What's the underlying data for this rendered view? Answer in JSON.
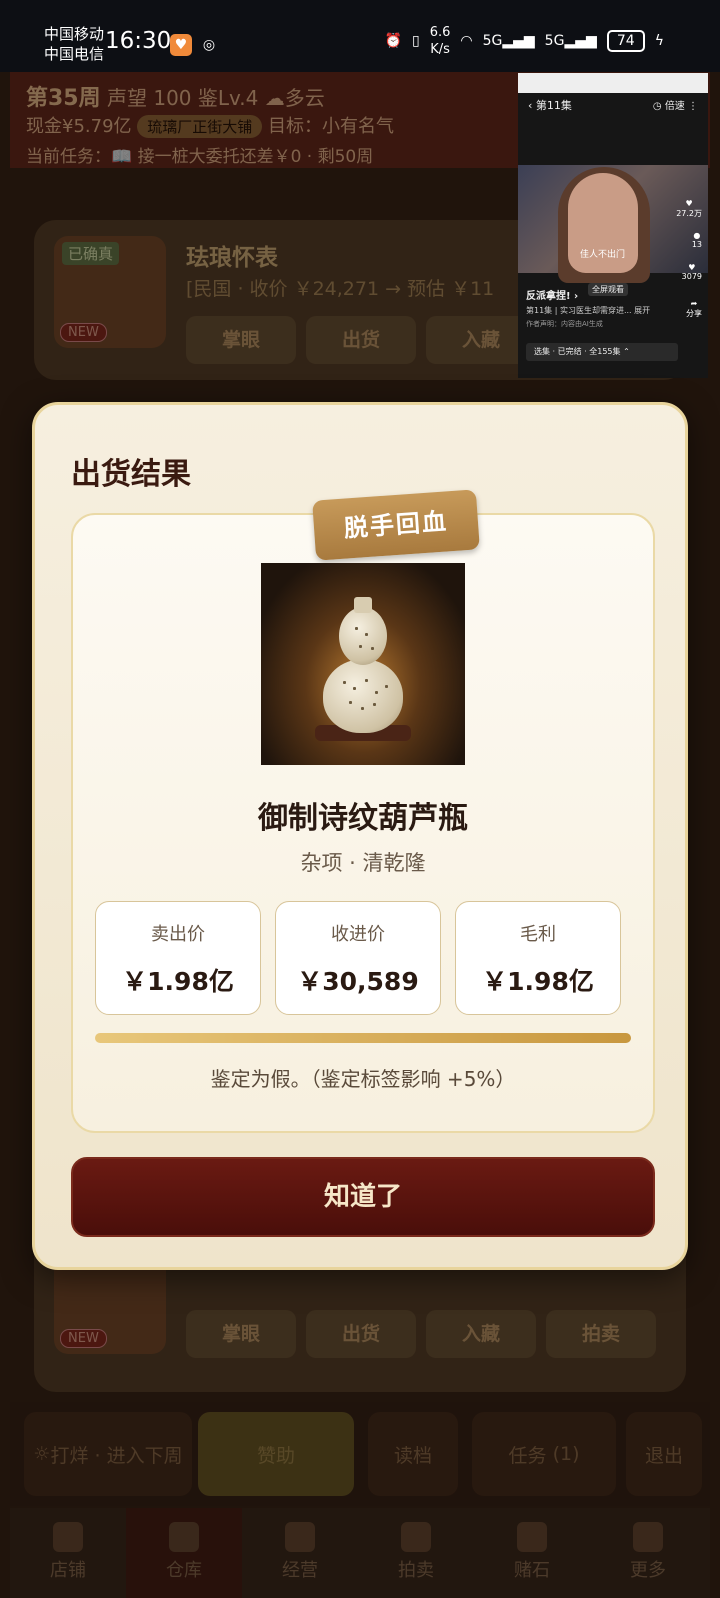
{
  "status_bar": {
    "carrier1": "中国移动",
    "carrier2": "中国电信",
    "time": "16:30",
    "net_speed_value": "6.6",
    "net_speed_unit": "K/s",
    "signal1": "5G",
    "signal2": "5G",
    "battery": "74"
  },
  "game_header": {
    "week": "第35周",
    "reputation": "声望 100",
    "appraisal_level": "鉴Lv.4",
    "weather": "多云",
    "cash": "现金¥5.79亿",
    "shop_badge": "琉璃厂正街大铺",
    "goal": "目标：小有名气",
    "task": "当前任务：📖 接一桩大委托还差￥0 · 剩50周"
  },
  "background_card_1": {
    "badge": "已确真",
    "new_tag": "NEW",
    "title": "珐琅怀表",
    "subtitle": "[民国 · 收价 ￥24,271 → 预估 ￥11",
    "buttons": [
      "掌眼",
      "出货",
      "入藏"
    ]
  },
  "background_card_2": {
    "new_tag": "NEW",
    "buttons": [
      "掌眼",
      "出货",
      "入藏",
      "拍卖"
    ]
  },
  "action_bar": {
    "next_week": "打烊 · 进入下周",
    "sponsor": "赞助",
    "save": "读档",
    "tasks": "任务",
    "tasks_count": "(1)",
    "exit": "退出"
  },
  "bottom_tabs": [
    "店铺",
    "仓库",
    "经营",
    "拍卖",
    "赌石",
    "更多"
  ],
  "mini_player": {
    "episode": "第11集",
    "speed": "倍速",
    "caption": "佳人不出门",
    "likes": "27.2万",
    "comments": "13",
    "favorites": "3079",
    "share": "分享",
    "title": "反派拿捏!",
    "fullscreen": "全屏观看",
    "desc": "第11集 | 实习医生却需穿进... 展开",
    "notice": "作者声明：内容由AI生成",
    "series": "选集 · 已完结 · 全155集"
  },
  "modal": {
    "title": "出货结果",
    "ribbon": "脱手回血",
    "item_name": "御制诗纹葫芦瓶",
    "item_meta": "杂项 · 清乾隆",
    "prices": [
      {
        "label": "卖出价",
        "value": "￥1.98亿"
      },
      {
        "label": "收进价",
        "value": "￥30,589"
      },
      {
        "label": "毛利",
        "value": "￥1.98亿"
      }
    ],
    "note": "鉴定为假。（鉴定标签影响 +5%）",
    "confirm_button": "知道了"
  }
}
